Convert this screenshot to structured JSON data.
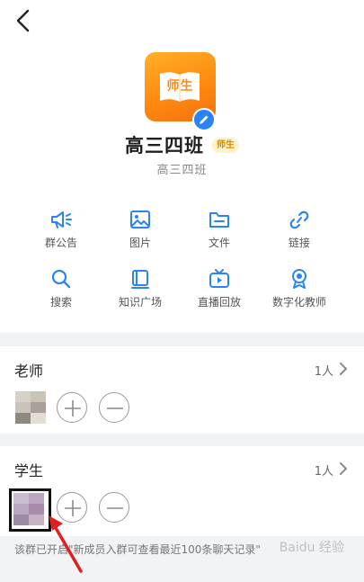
{
  "group": {
    "name": "高三四班",
    "role_badge": "师生",
    "subtitle": "高三四班",
    "avatar_text": "师生"
  },
  "features": [
    {
      "label": "群公告",
      "icon": "megaphone-icon"
    },
    {
      "label": "图片",
      "icon": "image-icon"
    },
    {
      "label": "文件",
      "icon": "folder-icon"
    },
    {
      "label": "链接",
      "icon": "link-icon"
    },
    {
      "label": "搜索",
      "icon": "search-icon"
    },
    {
      "label": "知识广场",
      "icon": "knowledge-icon"
    },
    {
      "label": "直播回放",
      "icon": "tv-replay-icon"
    },
    {
      "label": "数字化教师",
      "icon": "badge-icon"
    }
  ],
  "teachers": {
    "title": "老师",
    "count": "1人"
  },
  "students": {
    "title": "学生",
    "count": "1人"
  },
  "notice": "该群已开启\"新成员入群可查看最近100条聊天记录\"",
  "watermark": "Baidu 经验",
  "colors": {
    "accent": "#2a84f5",
    "avatar_orange": "#ff8a10",
    "annotation_red": "#e02020"
  }
}
